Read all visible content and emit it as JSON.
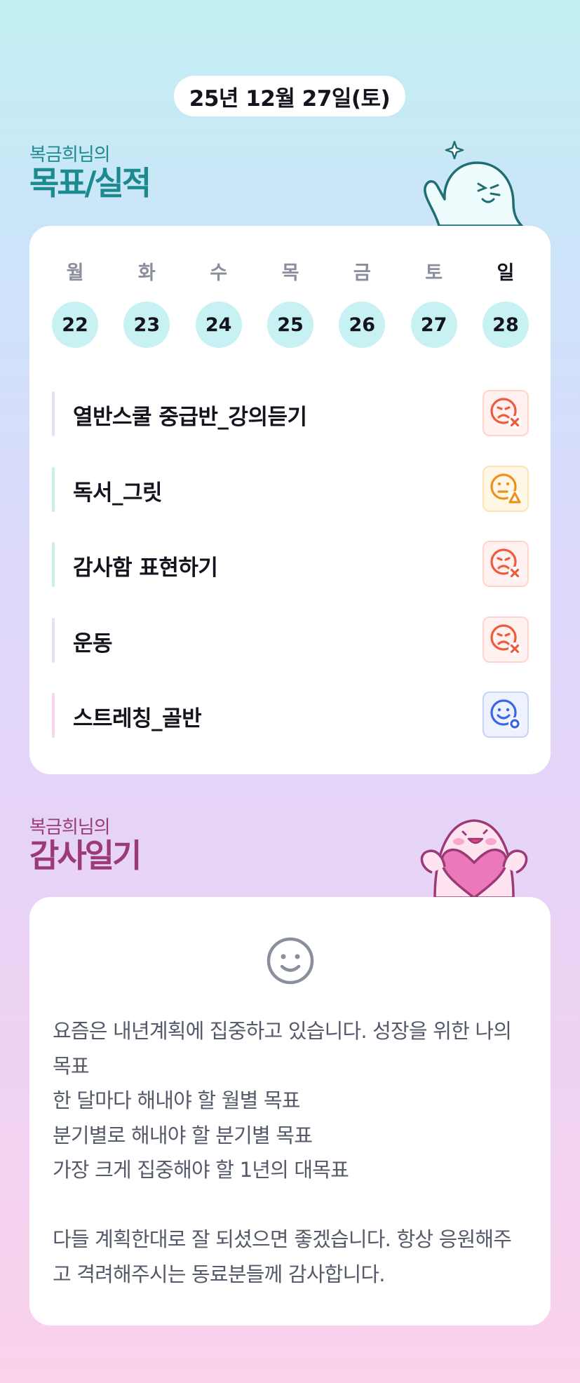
{
  "header": {
    "date": "25년 12월 27일(토)"
  },
  "goals_section": {
    "owner": "복금희님의",
    "title": "목표/실적"
  },
  "week": {
    "days": [
      {
        "name": "월",
        "num": "22"
      },
      {
        "name": "화",
        "num": "23"
      },
      {
        "name": "수",
        "num": "24"
      },
      {
        "name": "목",
        "num": "25"
      },
      {
        "name": "금",
        "num": "26"
      },
      {
        "name": "토",
        "num": "27"
      },
      {
        "name": "일",
        "num": "28"
      }
    ]
  },
  "goals": [
    {
      "label": "열반스쿨 중급반_강의듣기",
      "status": "failed",
      "bar_color": "#dfe4f2",
      "status_bg": "#fff1ef",
      "status_border": "#ffd4cc",
      "status_color": "#ee5a3a"
    },
    {
      "label": "독서_그릿",
      "status": "partial",
      "bar_color": "#cdeee2",
      "status_bg": "#fff7e6",
      "status_border": "#ffe2b3",
      "status_color": "#f0901a"
    },
    {
      "label": "감사함 표현하기",
      "status": "failed",
      "bar_color": "#cdeee2",
      "status_bg": "#fff1ef",
      "status_border": "#ffd4cc",
      "status_color": "#ee5a3a"
    },
    {
      "label": "운동",
      "status": "failed",
      "bar_color": "#dfe4f2",
      "status_bg": "#fff1ef",
      "status_border": "#ffd4cc",
      "status_color": "#ee5a3a"
    },
    {
      "label": "스트레칭_골반",
      "status": "achieved",
      "bar_color": "#fbd3ea",
      "status_bg": "#eef2ff",
      "status_border": "#c7d3f5",
      "status_color": "#3a66e6"
    }
  ],
  "gratitude_section": {
    "owner": "복금희님의",
    "title": "감사일기"
  },
  "journal": {
    "text": "요즘은 내년계획에 집중하고 있습니다. 성장을 위한 나의 목표\n한 달마다 해내야 할 월별 목표\n분기별로 해내야 할 분기별 목표\n가장 크게 집중해야 할 1년의 대목표\n\n다들 계획한대로 잘 되셨으면 좋겠습니다. 항상 응원해주고 격려해주시는 동료분들께 감사합니다."
  },
  "icons": {
    "mood": "smiley-icon",
    "failed": "sad-face-x-icon",
    "partial": "face-triangle-icon",
    "achieved": "smile-face-circle-icon"
  }
}
